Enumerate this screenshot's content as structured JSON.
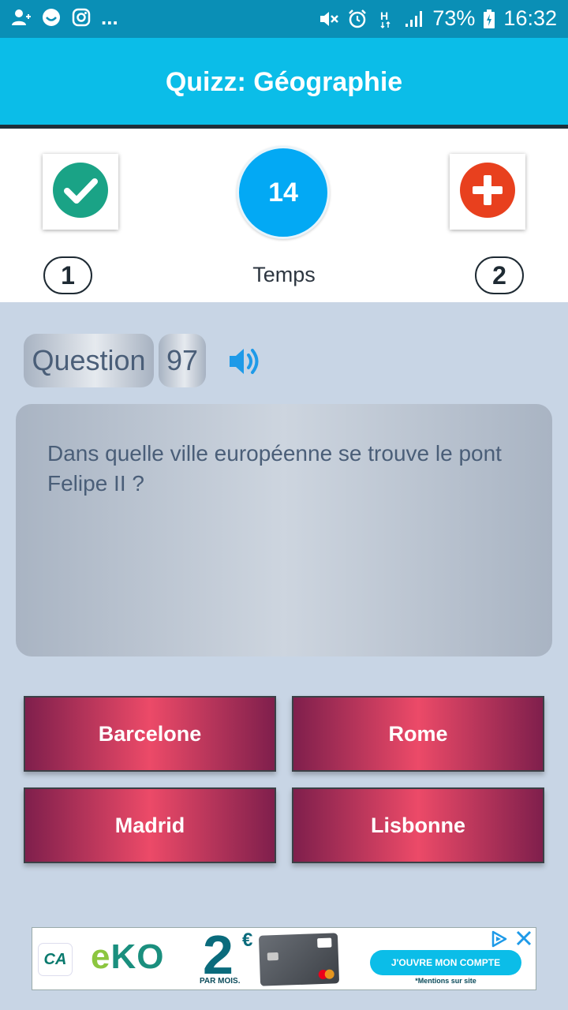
{
  "status_bar": {
    "battery": "73%",
    "time": "16:32",
    "more": "...",
    "left_icons": [
      "add-contact-icon",
      "smiley-icon",
      "instagram-icon"
    ],
    "right_icons": [
      "mute-icon",
      "alarm-icon",
      "network-h-icon",
      "signal-icon",
      "battery-icon"
    ]
  },
  "app_bar": {
    "title": "Quizz: Géographie"
  },
  "score": {
    "correct_count": "1",
    "wrong_count": "2",
    "timer_value": "14",
    "timer_label": "Temps",
    "correct_color": "#1aa386",
    "wrong_color": "#e8401e",
    "timer_color": "#03a9f4"
  },
  "question": {
    "label": "Question",
    "number": "97",
    "text": "Dans quelle ville européenne se trouve le pont Felipe II ?"
  },
  "answers": [
    {
      "label": "Barcelone"
    },
    {
      "label": "Rome"
    },
    {
      "label": "Madrid"
    },
    {
      "label": "Lisbonne"
    }
  ],
  "ad": {
    "brand": "CA",
    "product_e": "e",
    "product_rest": "KO",
    "price": "2",
    "currency": "€",
    "price_period": "PAR MOIS.",
    "cta": "J'OUVRE MON COMPTE",
    "note": "*Mentions sur site"
  },
  "colors": {
    "status_bar": "#0a8fb6",
    "app_bar": "#0bbde8",
    "background": "#c8d5e5",
    "answer_gradient_center": "#ec4a68",
    "answer_gradient_edge": "#7f1f4c"
  }
}
